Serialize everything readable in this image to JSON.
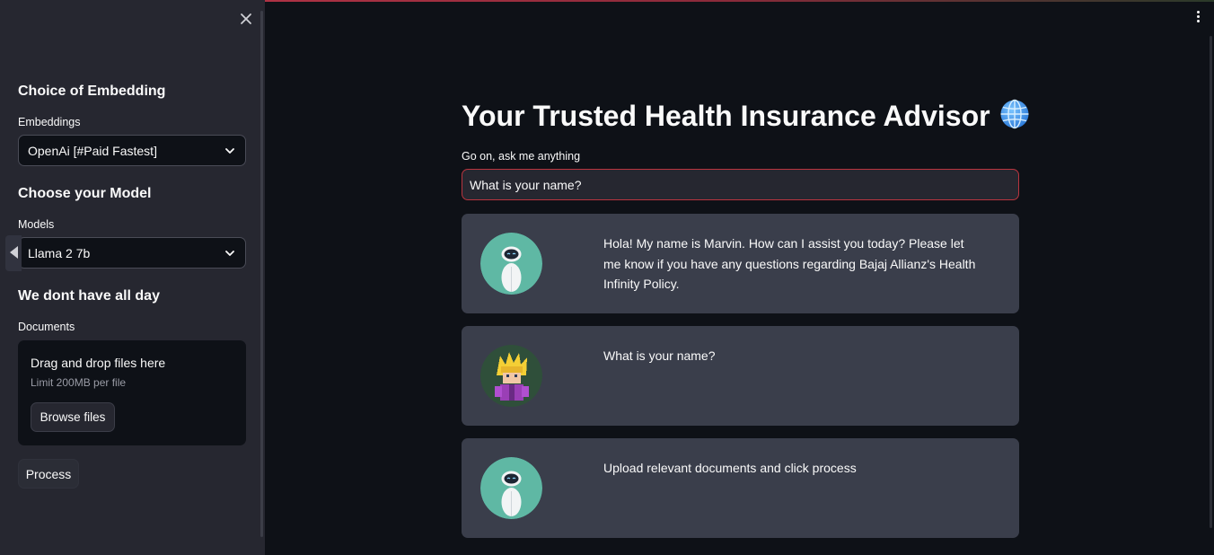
{
  "sidebar": {
    "embedding_heading": "Choice of Embedding",
    "embeddings_label": "Embeddings",
    "embeddings_value": "OpenAi [#Paid Fastest]",
    "model_heading": "Choose your Model",
    "models_label": "Models",
    "models_value": "Llama 2 7b",
    "docs_heading": "We dont have all day",
    "documents_label": "Documents",
    "dropzone_title": "Drag and drop files here",
    "dropzone_limit": "Limit 200MB per file",
    "browse_label": "Browse files",
    "process_label": "Process"
  },
  "main": {
    "title": "Your Trusted Health Insurance Advisor",
    "title_icon": "globe-icon",
    "input_label": "Go on, ask me anything",
    "input_value": "What is your name?",
    "messages": [
      {
        "role": "bot",
        "avatar": "robot-avatar",
        "text": "Hola! My name is Marvin. How can I assist you today? Please let me know if you have any questions regarding Bajaj Allianz's Health Infinity Policy."
      },
      {
        "role": "user",
        "avatar": "pixel-character-avatar",
        "text": "What is your name?"
      },
      {
        "role": "bot",
        "avatar": "robot-avatar",
        "text": "Upload relevant documents and click process"
      }
    ]
  },
  "colors": {
    "main_bg": "#0e1117",
    "sidebar_bg": "#262730",
    "message_bg": "#3a3e4b",
    "avatar_teal": "#5fb8a4",
    "input_border_focus": "#b8353f"
  }
}
